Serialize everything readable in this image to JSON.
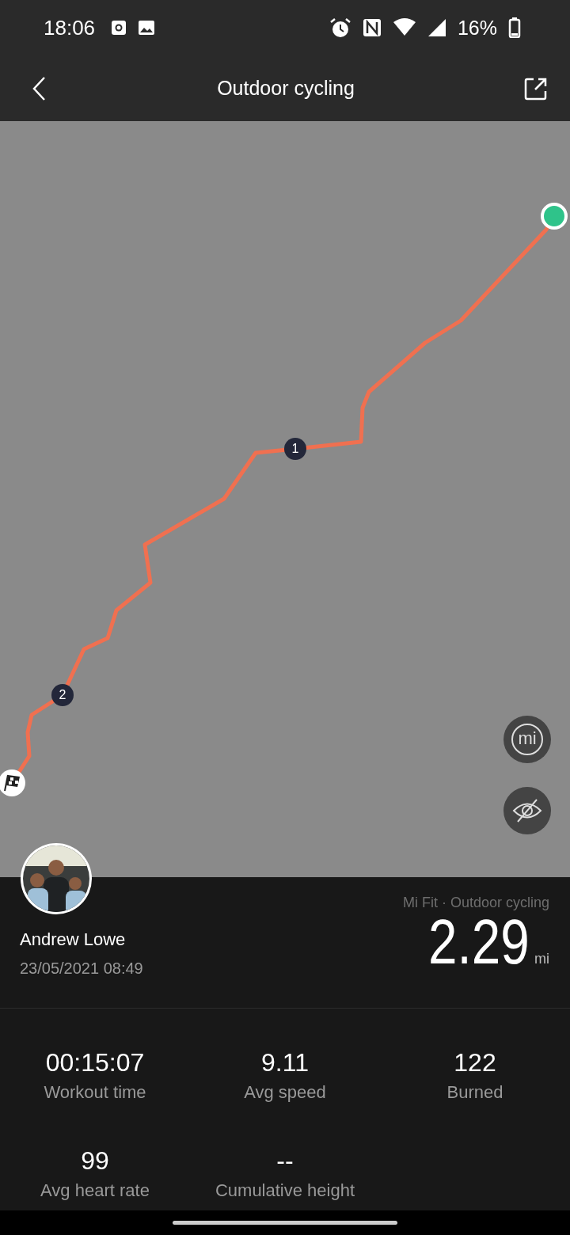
{
  "status_bar": {
    "time": "18:06",
    "battery": "16%"
  },
  "header": {
    "title": "Outdoor cycling"
  },
  "map": {
    "markers": [
      {
        "label": "1"
      },
      {
        "label": "2"
      }
    ],
    "mi_button": "mi"
  },
  "workout": {
    "user": "Andrew Lowe",
    "date": "23/05/2021 08:49",
    "source": "Mi Fit · Outdoor cycling",
    "distance": "2.29",
    "unit": "mi"
  },
  "stats": [
    {
      "value": "00:15:07",
      "label": "Workout time"
    },
    {
      "value": "9.11",
      "label": "Avg speed"
    },
    {
      "value": "122",
      "label": "Burned"
    },
    {
      "value": "99",
      "label": "Avg heart rate"
    },
    {
      "value": "--",
      "label": "Cumulative height"
    }
  ]
}
